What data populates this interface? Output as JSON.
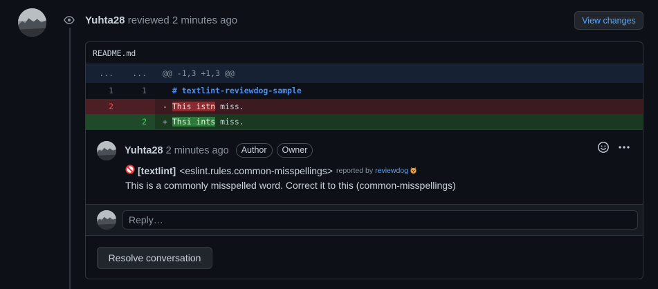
{
  "review": {
    "user": "Yuhta28",
    "action": "reviewed",
    "time": "2 minutes ago",
    "view_changes_label": "View changes"
  },
  "file": {
    "name": "README.md",
    "hunk": {
      "left": "...",
      "right": "...",
      "header": "@@ -1,3 +1,3 @@"
    },
    "lines": [
      {
        "type": "context",
        "old": "1",
        "new": "1",
        "prefix": " ",
        "text": "# textlint-reviewdog-sample"
      },
      {
        "type": "deleted",
        "old": "2",
        "new": "",
        "prefix": "-",
        "highlight": "This istn",
        "rest": " miss."
      },
      {
        "type": "added",
        "old": "",
        "new": "2",
        "prefix": "+",
        "highlight": "Thsi ints",
        "rest": " miss."
      }
    ]
  },
  "comment": {
    "user": "Yuhta28",
    "time": "2 minutes ago",
    "badges": [
      "Author",
      "Owner"
    ],
    "tool": "[textlint]",
    "rule": "<eslint.rules.common-misspellings>",
    "reported_by": "reported by",
    "reporter": "reviewdog",
    "message": "This is a commonly misspelled word. Correct it to this (common-misspellings)"
  },
  "reply": {
    "placeholder": "Reply…"
  },
  "resolve_label": "Resolve conversation",
  "icons": {
    "eye": "eye-icon",
    "smiley": "smiley-icon",
    "kebab": "kebab-horizontal-icon",
    "prohibited": "prohibited-icon",
    "dog": "dog-emoji-icon"
  },
  "colors": {
    "background": "#0d1117",
    "link": "#58a6ff",
    "deleted_line": "#3b1b20",
    "added_line": "#193a21",
    "hunk_header": "#162233"
  }
}
